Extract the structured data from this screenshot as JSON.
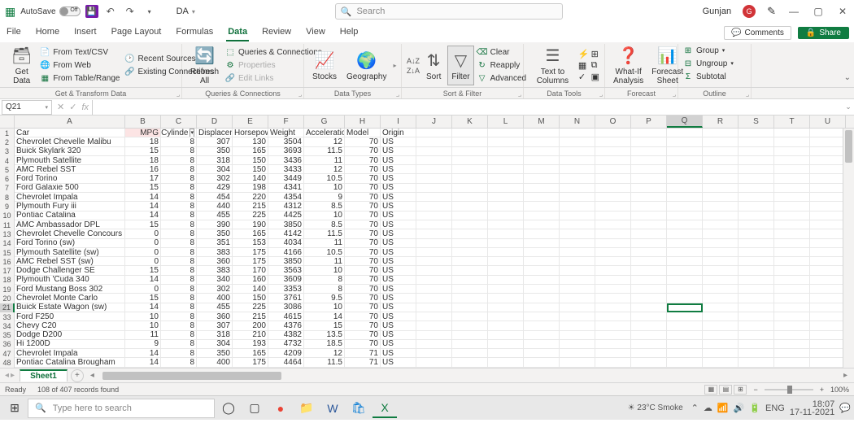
{
  "titlebar": {
    "autosave": "AutoSave",
    "autosave_state": "Off",
    "filename": "DA",
    "search_placeholder": "Search",
    "user": "Gunjan",
    "user_initial": "G"
  },
  "tabs": [
    "File",
    "Home",
    "Insert",
    "Page Layout",
    "Formulas",
    "Data",
    "Review",
    "View",
    "Help"
  ],
  "active_tab": "Data",
  "comments": "Comments",
  "share": "Share",
  "ribbon": {
    "groups": [
      "Get & Transform Data",
      "Queries & Connections",
      "Data Types",
      "Sort & Filter",
      "Data Tools",
      "Forecast",
      "Outline"
    ],
    "get_data": "Get\nData",
    "from_text": "From Text/CSV",
    "from_web": "From Web",
    "from_table": "From Table/Range",
    "recent_sources": "Recent Sources",
    "existing_conn": "Existing Connections",
    "refresh": "Refresh\nAll",
    "queries": "Queries & Connections",
    "properties": "Properties",
    "edit_links": "Edit Links",
    "stocks": "Stocks",
    "geography": "Geography",
    "sort": "Sort",
    "filter": "Filter",
    "clear": "Clear",
    "reapply": "Reapply",
    "advanced": "Advanced",
    "text_to_cols": "Text to\nColumns",
    "whatif": "What-If\nAnalysis",
    "forecast": "Forecast\nSheet",
    "group": "Group",
    "ungroup": "Ungroup",
    "subtotal": "Subtotal"
  },
  "namebox": "Q21",
  "columns": [
    "A",
    "B",
    "C",
    "D",
    "E",
    "F",
    "G",
    "H",
    "I",
    "J",
    "K",
    "L",
    "M",
    "N",
    "O",
    "P",
    "Q",
    "R",
    "S",
    "T",
    "U"
  ],
  "active_col": "Q",
  "active_row": "21",
  "headers": [
    "Car",
    "MPG",
    "Cylinders",
    "Displacement",
    "Horsepower",
    "Weight",
    "Acceleration",
    "Model",
    "Origin"
  ],
  "header_display": [
    "Car",
    "MPG",
    "Cylinde",
    "Displacem",
    "Horsepow",
    "Weight",
    "Acceleration",
    "Model",
    "Origin"
  ],
  "rows": [
    {
      "n": 2,
      "d": [
        "Chevrolet Chevelle Malibu",
        18,
        8,
        307,
        130,
        3504,
        12,
        70,
        "US"
      ]
    },
    {
      "n": 3,
      "d": [
        "Buick Skylark 320",
        15,
        8,
        350,
        165,
        3693,
        11.5,
        70,
        "US"
      ]
    },
    {
      "n": 4,
      "d": [
        "Plymouth Satellite",
        18,
        8,
        318,
        150,
        3436,
        11,
        70,
        "US"
      ]
    },
    {
      "n": 5,
      "d": [
        "AMC Rebel SST",
        16,
        8,
        304,
        150,
        3433,
        12,
        70,
        "US"
      ]
    },
    {
      "n": 6,
      "d": [
        "Ford Torino",
        17,
        8,
        302,
        140,
        3449,
        10.5,
        70,
        "US"
      ]
    },
    {
      "n": 7,
      "d": [
        "Ford Galaxie 500",
        15,
        8,
        429,
        198,
        4341,
        10,
        70,
        "US"
      ]
    },
    {
      "n": 8,
      "d": [
        "Chevrolet Impala",
        14,
        8,
        454,
        220,
        4354,
        9,
        70,
        "US"
      ]
    },
    {
      "n": 9,
      "d": [
        "Plymouth Fury iii",
        14,
        8,
        440,
        215,
        4312,
        8.5,
        70,
        "US"
      ]
    },
    {
      "n": 10,
      "d": [
        "Pontiac Catalina",
        14,
        8,
        455,
        225,
        4425,
        10,
        70,
        "US"
      ]
    },
    {
      "n": 11,
      "d": [
        "AMC Ambassador DPL",
        15,
        8,
        390,
        190,
        3850,
        8.5,
        70,
        "US"
      ]
    },
    {
      "n": 13,
      "d": [
        "Chevrolet Chevelle Concours (sw)",
        0,
        8,
        350,
        165,
        4142,
        11.5,
        70,
        "US"
      ]
    },
    {
      "n": 14,
      "d": [
        "Ford Torino (sw)",
        0,
        8,
        351,
        153,
        4034,
        11,
        70,
        "US"
      ]
    },
    {
      "n": 15,
      "d": [
        "Plymouth Satellite (sw)",
        0,
        8,
        383,
        175,
        4166,
        10.5,
        70,
        "US"
      ]
    },
    {
      "n": 16,
      "d": [
        "AMC Rebel SST (sw)",
        0,
        8,
        360,
        175,
        3850,
        11,
        70,
        "US"
      ]
    },
    {
      "n": 17,
      "d": [
        "Dodge Challenger SE",
        15,
        8,
        383,
        170,
        3563,
        10,
        70,
        "US"
      ]
    },
    {
      "n": 18,
      "d": [
        "Plymouth 'Cuda 340",
        14,
        8,
        340,
        160,
        3609,
        8,
        70,
        "US"
      ]
    },
    {
      "n": 19,
      "d": [
        "Ford Mustang Boss 302",
        0,
        8,
        302,
        140,
        3353,
        8,
        70,
        "US"
      ]
    },
    {
      "n": 20,
      "d": [
        "Chevrolet Monte Carlo",
        15,
        8,
        400,
        150,
        3761,
        9.5,
        70,
        "US"
      ]
    },
    {
      "n": 21,
      "d": [
        "Buick Estate Wagon (sw)",
        14,
        8,
        455,
        225,
        3086,
        10,
        70,
        "US"
      ]
    },
    {
      "n": 33,
      "d": [
        "Ford F250",
        10,
        8,
        360,
        215,
        4615,
        14,
        70,
        "US"
      ]
    },
    {
      "n": 34,
      "d": [
        "Chevy C20",
        10,
        8,
        307,
        200,
        4376,
        15,
        70,
        "US"
      ]
    },
    {
      "n": 35,
      "d": [
        "Dodge D200",
        11,
        8,
        318,
        210,
        4382,
        13.5,
        70,
        "US"
      ]
    },
    {
      "n": 36,
      "d": [
        "Hi 1200D",
        9,
        8,
        304,
        193,
        4732,
        18.5,
        70,
        "US"
      ]
    },
    {
      "n": 47,
      "d": [
        "Chevrolet Impala",
        14,
        8,
        350,
        165,
        4209,
        12,
        71,
        "US"
      ]
    },
    {
      "n": 48,
      "d": [
        "Pontiac Catalina Brougham",
        14,
        8,
        400,
        175,
        4464,
        11.5,
        71,
        "US"
      ]
    }
  ],
  "sheet": "Sheet1",
  "status": {
    "ready": "Ready",
    "records": "108 of 407 records found",
    "zoom": "100%"
  },
  "taskbar": {
    "search": "Type here to search",
    "weather": "23°C Smoke",
    "lang": "ENG",
    "time": "18:07",
    "date": "17-11-2021"
  }
}
